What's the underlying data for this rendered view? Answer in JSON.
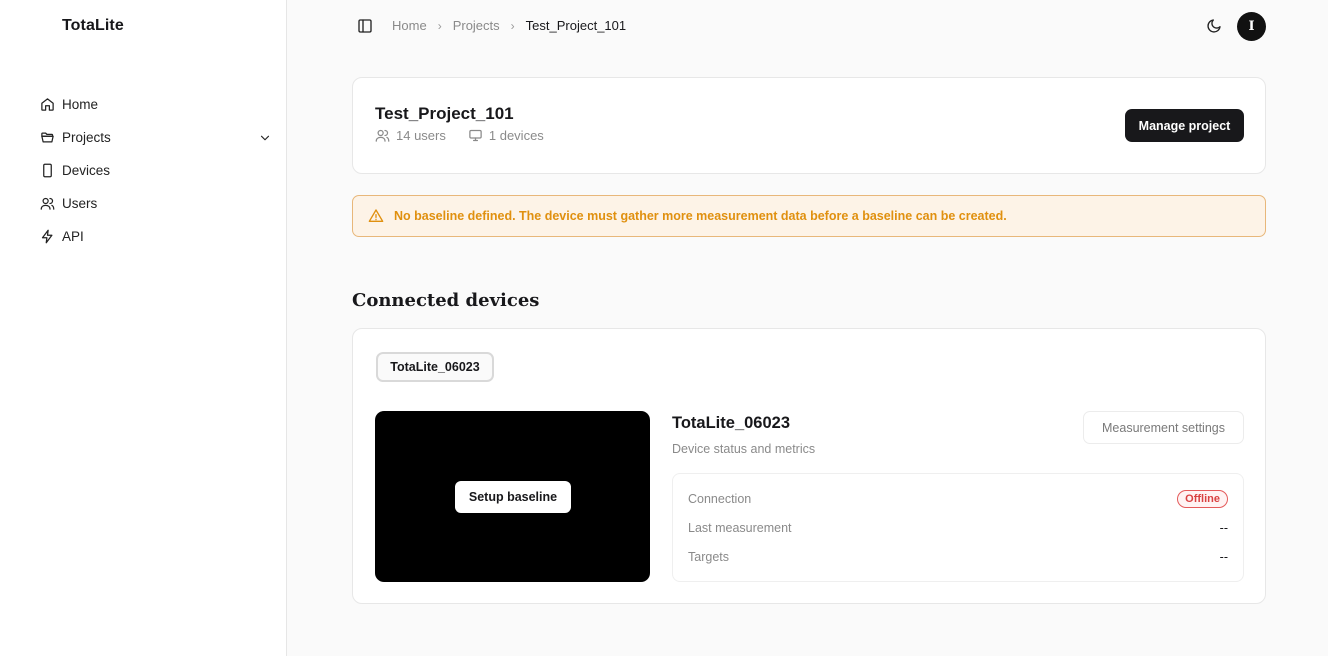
{
  "app": {
    "brand": "TotaLite"
  },
  "sidebar": {
    "items": [
      {
        "label": "Home",
        "icon": "home-icon"
      },
      {
        "label": "Projects",
        "icon": "folder-icon"
      },
      {
        "label": "Devices",
        "icon": "device-icon"
      },
      {
        "label": "Users",
        "icon": "users-icon"
      },
      {
        "label": "API",
        "icon": "bolt-icon"
      }
    ]
  },
  "header": {
    "breadcrumbs": [
      "Home",
      "Projects",
      "Test_Project_101"
    ],
    "avatar_initial": "I"
  },
  "project": {
    "title": "Test_Project_101",
    "users": "14 users",
    "devices": "1 devices",
    "manage_label": "Manage project"
  },
  "alert": {
    "text": "No baseline defined. The device must gather more measurement data before a baseline can be created.",
    "color": "#e0900f"
  },
  "devices_section": {
    "title": "Connected devices",
    "tab_label": "TotaLite_06023",
    "setup_label": "Setup baseline",
    "device": {
      "name": "TotaLite_06023",
      "subtitle": "Device status and metrics",
      "settings_label": "Measurement settings",
      "metrics": [
        {
          "label": "Connection",
          "value": "Offline",
          "status_color": "#d94141"
        },
        {
          "label": "Last measurement",
          "value": "--"
        },
        {
          "label": "Targets",
          "value": "--"
        }
      ]
    }
  }
}
